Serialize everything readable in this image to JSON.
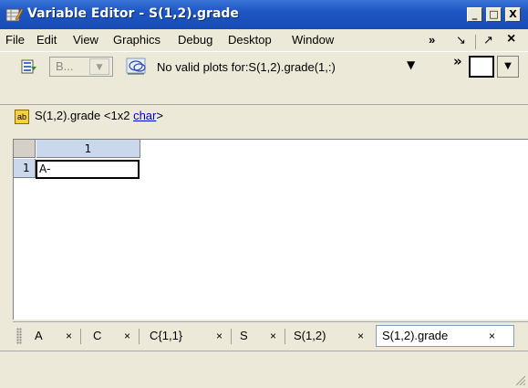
{
  "window": {
    "title": "Variable Editor - S(1,2).grade",
    "minimize": "_",
    "maximize": "□",
    "close": "X"
  },
  "menu": {
    "items": [
      "File",
      "Edit",
      "View",
      "Graphics",
      "Debug",
      "Desktop",
      "Window"
    ],
    "overflow": "»",
    "dock_glyph": "↘",
    "undock_glyph": "↗",
    "close_glyph": "×"
  },
  "toolbar": {
    "combo_value": "B...",
    "plot_text": "No valid plots for:S(1,2).grade(1,:)",
    "more": "»"
  },
  "info": {
    "icon_text": "ab",
    "variable": "S(1,2).grade",
    "size_prefix": "<1x2 ",
    "type_link": "char",
    "size_suffix": ">"
  },
  "grid": {
    "column_headers": [
      "1"
    ],
    "row_headers": [
      "1"
    ],
    "cells": [
      [
        "A-"
      ]
    ]
  },
  "tabs": [
    {
      "label": "A",
      "close": "×"
    },
    {
      "label": "C",
      "close": "×"
    },
    {
      "label": "C{1,1}",
      "close": "×"
    },
    {
      "label": "S",
      "close": "×"
    },
    {
      "label": "S(1,2)",
      "close": "×"
    },
    {
      "label": "S(1,2).grade",
      "close": "×",
      "active": true
    }
  ],
  "colors": {
    "title_bar": "#1d56c4",
    "header_highlight": "#c9d8ec",
    "link": "#0000cc"
  }
}
